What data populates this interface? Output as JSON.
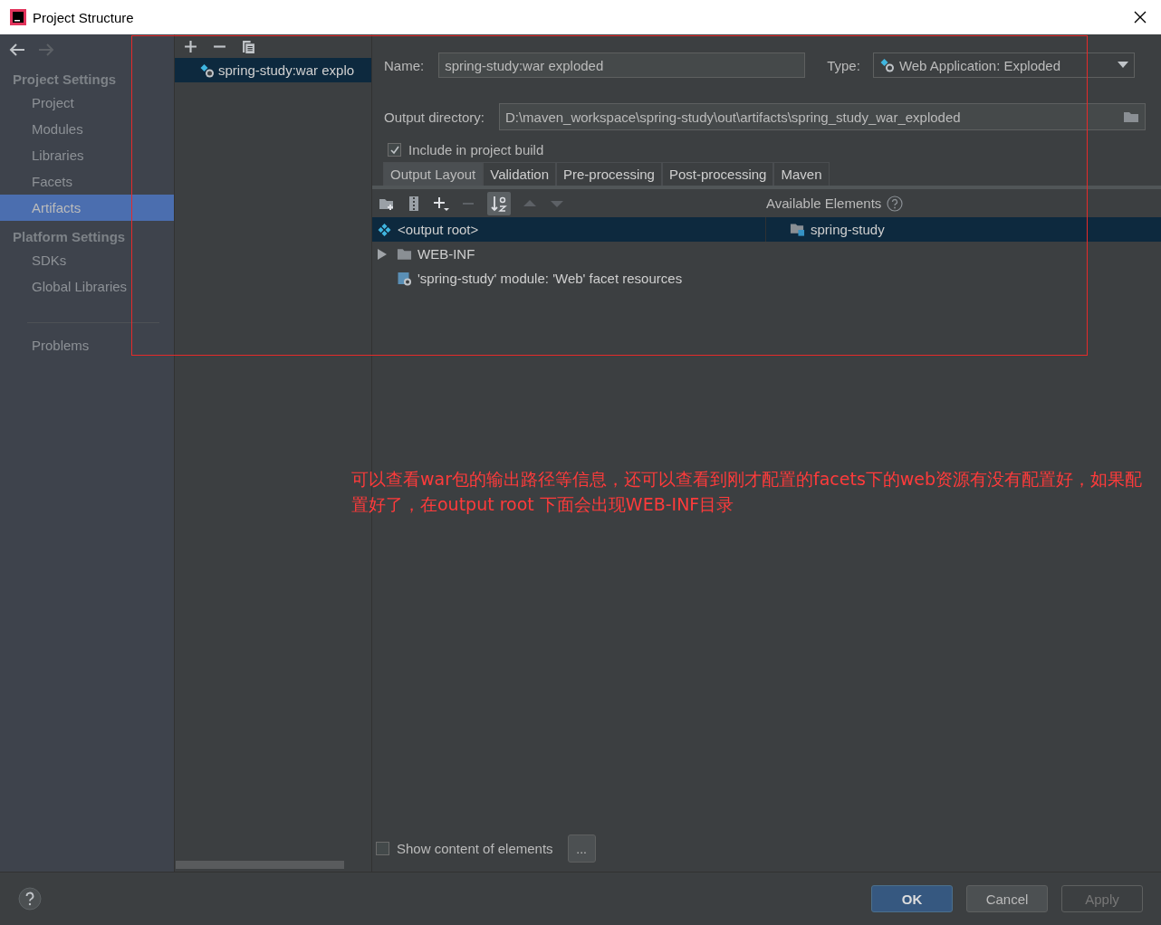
{
  "window": {
    "title": "Project Structure"
  },
  "sidebar": {
    "sections": [
      {
        "heading": "Project Settings",
        "items": [
          {
            "label": "Project",
            "selected": false
          },
          {
            "label": "Modules",
            "selected": false
          },
          {
            "label": "Libraries",
            "selected": false
          },
          {
            "label": "Facets",
            "selected": false
          },
          {
            "label": "Artifacts",
            "selected": true
          }
        ]
      },
      {
        "heading": "Platform Settings",
        "items": [
          {
            "label": "SDKs",
            "selected": false
          },
          {
            "label": "Global Libraries",
            "selected": false
          }
        ]
      }
    ],
    "extra_items": [
      {
        "label": "Problems",
        "selected": false
      }
    ]
  },
  "artifacts": [
    {
      "label": "spring-study:war explo",
      "selected": true
    }
  ],
  "form": {
    "name_label": "Name:",
    "name_value": "spring-study:war exploded",
    "type_label": "Type:",
    "type_value": "Web Application: Exploded",
    "output_label": "Output directory:",
    "output_value": "D:\\maven_workspace\\spring-study\\out\\artifacts\\spring_study_war_exploded",
    "include_label": "Include in project build",
    "include_checked": true
  },
  "tabs": [
    {
      "label": "Output Layout",
      "selected": true
    },
    {
      "label": "Validation",
      "selected": false
    },
    {
      "label": "Pre-processing",
      "selected": false
    },
    {
      "label": "Post-processing",
      "selected": false
    },
    {
      "label": "Maven",
      "selected": false
    }
  ],
  "available_label": "Available Elements",
  "layout_tree": [
    {
      "label": "<output root>",
      "selected": true,
      "children": [
        {
          "label": "WEB-INF",
          "kind": "folder",
          "expanded": false,
          "selected": false
        },
        {
          "label": "'spring-study' module: 'Web' facet resources",
          "kind": "facet",
          "selected": false
        }
      ]
    }
  ],
  "available_tree": [
    {
      "label": "spring-study",
      "selected": true
    }
  ],
  "show_content": {
    "label": "Show content of elements",
    "checked": false,
    "button": "..."
  },
  "buttons": [
    {
      "label": "OK",
      "default": true,
      "disabled": false
    },
    {
      "label": "Cancel",
      "default": false,
      "disabled": false
    },
    {
      "label": "Apply",
      "default": false,
      "disabled": true
    }
  ],
  "annotation": {
    "text": "可以查看war包的输出路径等信息，还可以查看到刚才配置的facets下的web资源有没有配置好，如果配置好了，在output root 下面会出现WEB-INF目录"
  }
}
